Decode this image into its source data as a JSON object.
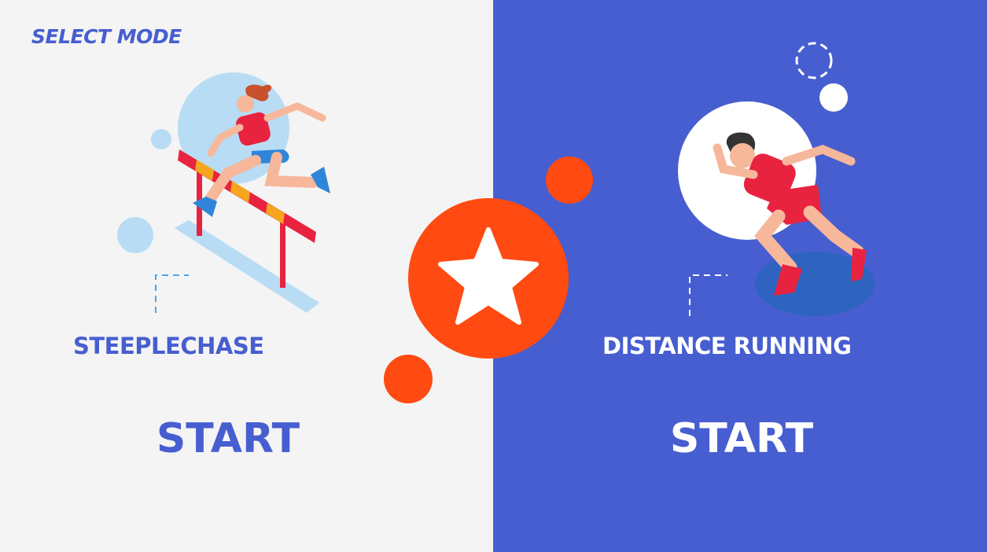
{
  "header": {
    "title": "SELECT MODE"
  },
  "modes": [
    {
      "label": "STEEPLECHASE",
      "start_label": "START"
    },
    {
      "label": "DISTANCE RUNNING",
      "start_label": "START"
    }
  ],
  "icons": {
    "left_illustration": "hurdler-icon",
    "right_illustration": "sprinter-icon",
    "center_badge": "star-icon"
  },
  "colors": {
    "accent_blue": "#475ed0",
    "left_background": "#f4f4f4",
    "badge_orange": "#ff4a12",
    "light_blue": "#b8dcf4"
  }
}
